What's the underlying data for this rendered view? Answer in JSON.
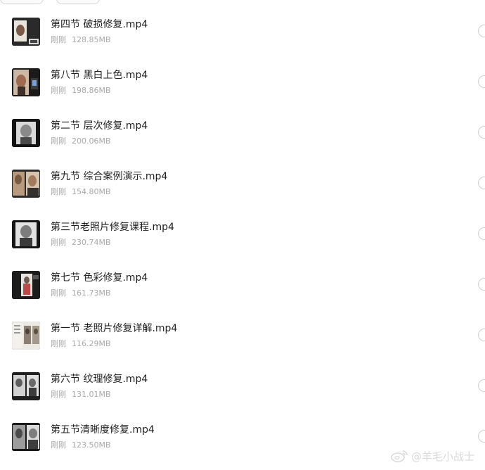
{
  "files": [
    {
      "name": "第四节 破损修复.mp4",
      "time": "刚刚",
      "size": "128.85MB",
      "thumb_icon": "video-thumbnail-icon"
    },
    {
      "name": "第八节 黑白上色.mp4",
      "time": "刚刚",
      "size": "198.86MB",
      "thumb_icon": "video-thumbnail-icon"
    },
    {
      "name": "第二节 层次修复.mp4",
      "time": "刚刚",
      "size": "200.06MB",
      "thumb_icon": "video-thumbnail-icon"
    },
    {
      "name": "第九节 综合案例演示.mp4",
      "time": "刚刚",
      "size": "154.80MB",
      "thumb_icon": "video-thumbnail-icon"
    },
    {
      "name": "第三节老照片修复课程.mp4",
      "time": "刚刚",
      "size": "230.74MB",
      "thumb_icon": "video-thumbnail-icon"
    },
    {
      "name": "第七节 色彩修复.mp4",
      "time": "刚刚",
      "size": "161.73MB",
      "thumb_icon": "video-thumbnail-icon"
    },
    {
      "name": "第一节 老照片修复详解.mp4",
      "time": "刚刚",
      "size": "116.29MB",
      "thumb_icon": "video-thumbnail-icon"
    },
    {
      "name": "第六节 纹理修复.mp4",
      "time": "刚刚",
      "size": "131.01MB",
      "thumb_icon": "video-thumbnail-icon"
    },
    {
      "name": "第五节清晰度修复.mp4",
      "time": "刚刚",
      "size": "123.50MB",
      "thumb_icon": "video-thumbnail-icon"
    }
  ],
  "watermark": {
    "text": "@羊毛小战士",
    "icon": "weibo-logo-icon"
  },
  "colors": {
    "name": "#1f1f1f",
    "meta": "#a8a8a8",
    "radio_border": "#cfcfcf",
    "watermark": "#d9d9d9"
  }
}
